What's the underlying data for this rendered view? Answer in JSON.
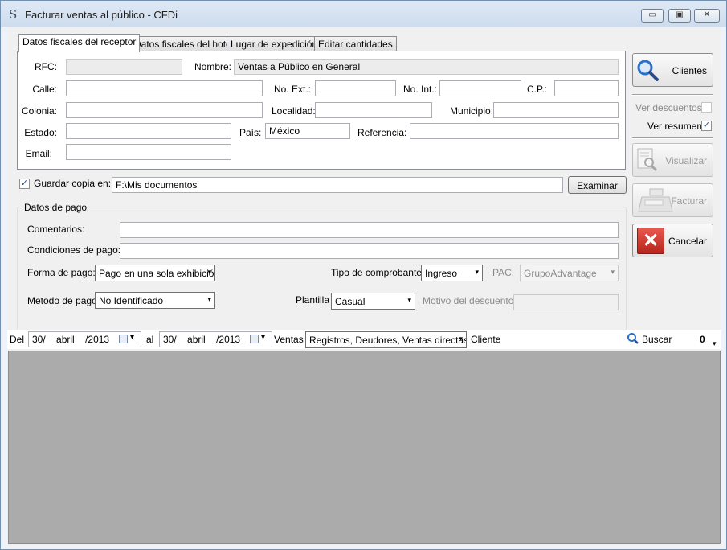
{
  "window": {
    "title": "Facturar ventas al público - CFDi",
    "app_icon": "S",
    "minimize_glyph": "▭",
    "maximize_glyph": "▣",
    "close_glyph": "✕"
  },
  "tabs": [
    {
      "label": "Datos fiscales del receptor",
      "active": true
    },
    {
      "label": "Datos fiscales del hotel",
      "active": false
    },
    {
      "label": "Lugar de expedición",
      "active": false
    },
    {
      "label": "Editar cantidades",
      "active": false
    }
  ],
  "receptor": {
    "rfc_label": "RFC:",
    "rfc_value": "",
    "nombre_label": "Nombre:",
    "nombre_value": "Ventas a Público en General",
    "calle_label": "Calle:",
    "calle_value": "",
    "noext_label": "No. Ext.:",
    "noext_value": "",
    "noint_label": "No. Int.:",
    "noint_value": "",
    "cp_label": "C.P.:",
    "cp_value": "",
    "colonia_label": "Colonia:",
    "colonia_value": "",
    "localidad_label": "Localidad:",
    "localidad_value": "",
    "municipio_label": "Municipio:",
    "municipio_value": "",
    "estado_label": "Estado:",
    "estado_value": "",
    "pais_label": "País:",
    "pais_value": "México",
    "referencia_label": "Referencia:",
    "referencia_value": "",
    "email_label": "Email:",
    "email_value": ""
  },
  "guardar": {
    "checked": true,
    "check_glyph": "✓",
    "label": "Guardar copia en:",
    "path": "F:\\Mis documentos",
    "examinar_label": "Examinar"
  },
  "pago": {
    "group_title": "Datos de pago",
    "comentarios_label": "Comentarios:",
    "comentarios_value": "",
    "condiciones_label": "Condiciones de pago:",
    "condiciones_value": "",
    "forma_label": "Forma de pago:",
    "forma_value": "Pago en una sola exhibició",
    "tipo_label": "Tipo de comprobante:",
    "tipo_value": "Ingreso",
    "pac_label": "PAC:",
    "pac_value": "GrupoAdvantage",
    "metodo_label": "Metodo de pago:",
    "metodo_value": "No Identificado",
    "plantilla_label": "Plantilla",
    "plantilla_value": "Casual",
    "motivo_label": "Motivo del descuento:",
    "motivo_value": ""
  },
  "side": {
    "clientes_label": "Clientes",
    "ver_descuentos_label": "Ver descuentos",
    "ver_descuentos_checked": false,
    "ver_resumen_label": "Ver resumen",
    "ver_resumen_checked": true,
    "check_glyph": "✓",
    "visualizar_label": "Visualizar",
    "facturar_label": "Facturar",
    "cancelar_label": "Cancelar",
    "cancel_glyph": "✕"
  },
  "filter": {
    "del_label": "Del",
    "del_day": "30/",
    "del_month": "abril",
    "del_year": "/2013",
    "al_label": "al",
    "al_day": "30/",
    "al_month": "abril",
    "al_year": "/2013",
    "ventas_label": "Ventas",
    "ventas_value": "Registros, Deudores, Ventas directas",
    "cliente_label": "Cliente",
    "buscar_label": "Buscar",
    "count": "0",
    "dropdown_glyph": "▾",
    "date_arrow_glyph": "▾",
    "scroll_glyph": "▾"
  },
  "icons": {
    "search": "search-icon",
    "calendar": "calendar-icon",
    "cancel": "cancel-icon",
    "print": "print-preview-icon",
    "register": "cash-register-icon"
  },
  "colors": {
    "accent": "#2a6fc9",
    "cancel_red": "#d63a2f",
    "grid_bg": "#ababab"
  }
}
